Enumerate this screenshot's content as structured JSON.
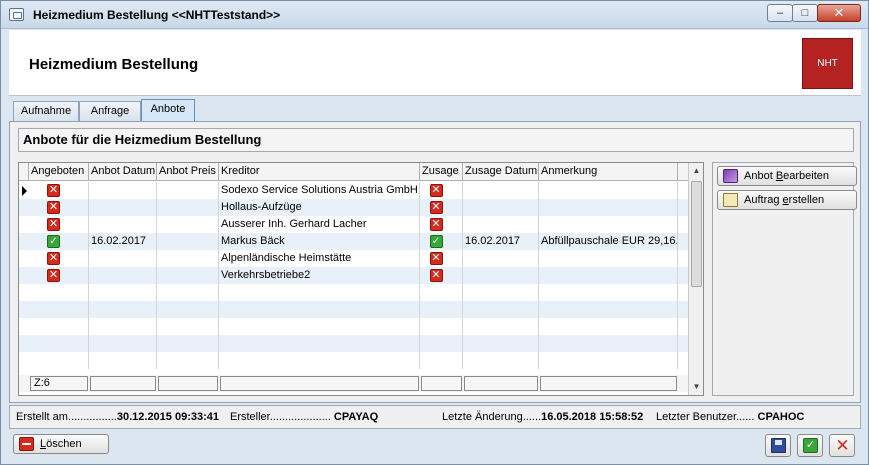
{
  "window": {
    "title": "Heizmedium Bestellung  <<NHTTeststand>>",
    "controls": {
      "minimize": "–",
      "maximize": "□",
      "close": "✕"
    }
  },
  "header": {
    "title": "Heizmedium Bestellung",
    "logo_text": "NHT",
    "logo_color": "#b52222"
  },
  "tabs": [
    {
      "label": "Aufnahme",
      "active": false
    },
    {
      "label": "Anfrage",
      "active": false
    },
    {
      "label": "Anbote",
      "active": true
    }
  ],
  "section": {
    "title": "Anbote für die Heizmedium Bestellung"
  },
  "grid": {
    "columns": [
      "Angeboten",
      "Anbot Datum",
      "Anbot Preis",
      "Kreditor",
      "Zusage",
      "Zusage Datum",
      "Anmerkung"
    ],
    "rows": [
      {
        "angeboten": "x",
        "anbot_datum": "",
        "anbot_preis": "",
        "kreditor": "Sodexo Service Solutions Austria GmbH",
        "zusage": "x",
        "zusage_datum": "",
        "anmerkung": ""
      },
      {
        "angeboten": "x",
        "anbot_datum": "",
        "anbot_preis": "",
        "kreditor": "Hollaus-Aufzüge",
        "zusage": "x",
        "zusage_datum": "",
        "anmerkung": ""
      },
      {
        "angeboten": "x",
        "anbot_datum": "",
        "anbot_preis": "",
        "kreditor": "Ausserer Inh. Gerhard Lacher",
        "zusage": "x",
        "zusage_datum": "",
        "anmerkung": ""
      },
      {
        "angeboten": "ok",
        "anbot_datum": "16.02.2017",
        "anbot_preis": "",
        "kreditor": "Markus  Bäck",
        "zusage": "ok",
        "zusage_datum": "16.02.2017",
        "anmerkung": "Abfüllpauschale EUR 29,16."
      },
      {
        "angeboten": "x",
        "anbot_datum": "",
        "anbot_preis": "",
        "kreditor": "Alpenländische Heimstätte",
        "zusage": "x",
        "zusage_datum": "",
        "anmerkung": ""
      },
      {
        "angeboten": "x",
        "anbot_datum": "",
        "anbot_preis": "",
        "kreditor": "Verkehrsbetriebe2",
        "zusage": "x",
        "zusage_datum": "",
        "anmerkung": ""
      }
    ],
    "footer_count": "Z:6",
    "status_colors": {
      "x": "#d62b1c",
      "ok": "#39a63a"
    }
  },
  "side_buttons": {
    "edit_prefix": "Anbot ",
    "edit_underline": "B",
    "edit_suffix": "earbeiten",
    "order_prefix": "Auftrag ",
    "order_underline": "e",
    "order_suffix": "rstellen"
  },
  "info": {
    "created_label": "Erstellt am................",
    "created_value": "30.12.2015 09:33:41",
    "creator_label": "Ersteller....................",
    "creator_value": "CPAYAQ",
    "changed_label": "Letzte Änderung......",
    "changed_value": "16.05.2018 15:58:52",
    "last_user_label": "Letzter Benutzer......",
    "last_user_value": "CPAHOC"
  },
  "bottom": {
    "delete_underline": "L",
    "delete_suffix": "öschen"
  }
}
